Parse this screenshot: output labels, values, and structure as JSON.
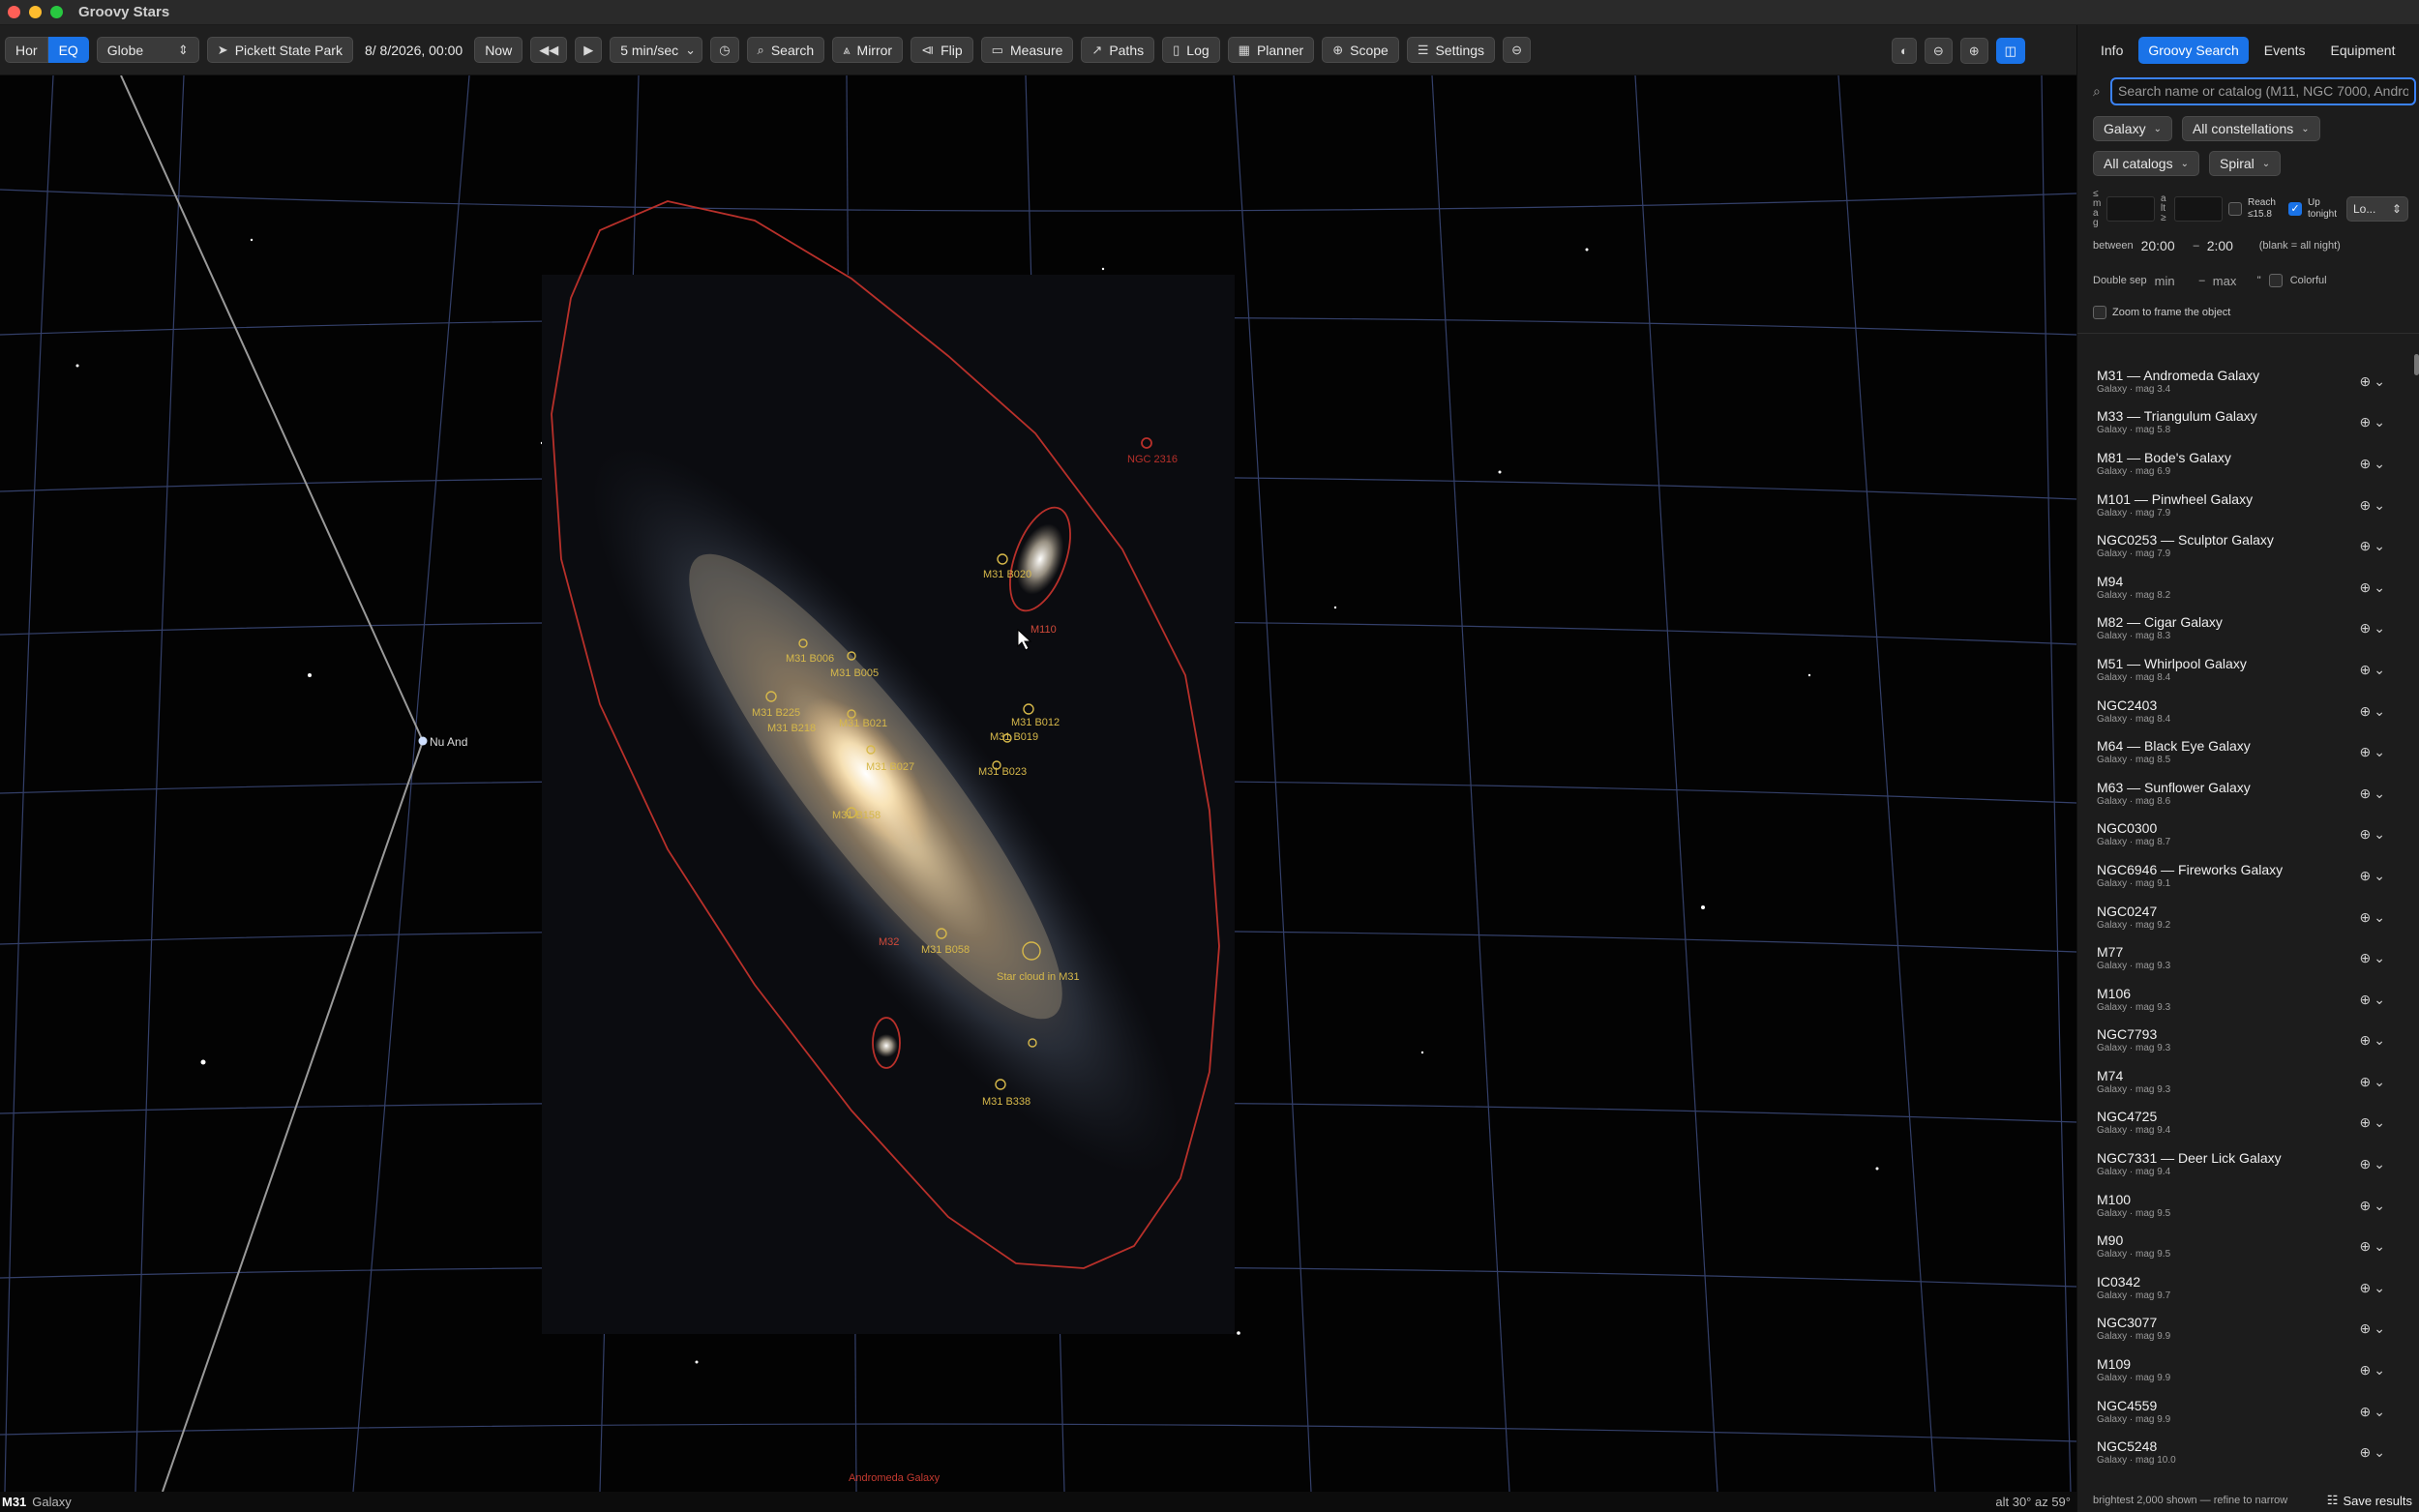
{
  "app": {
    "title": "Groovy Stars"
  },
  "toolbar": {
    "hor": "Hor",
    "eq": "EQ",
    "projection": "Globe",
    "location": "Pickett State Park",
    "date": "8/  8/2026, 00:00",
    "now": "Now",
    "rate": "5 min/sec",
    "search": "Search",
    "mirror": "Mirror",
    "flip": "Flip",
    "measure": "Measure",
    "paths": "Paths",
    "log": "Log",
    "planner": "Planner",
    "scope": "Scope",
    "settings": "Settings"
  },
  "sky": {
    "star_label": "Nu And",
    "main_label": "Andromeda Galaxy",
    "labels": {
      "ngc2316": "NGC 2316",
      "b020": "M31 B020",
      "m110": "M110",
      "b006": "M31 B006",
      "b005": "M31 B005",
      "b225": "M31 B225",
      "b218": "M31 B218",
      "b012": "M31 B012",
      "b019": "M31 B019",
      "b023": "M31 B023",
      "b021": "M31 B021",
      "b027": "M31 B027",
      "b158": "M31 B158",
      "m32": "M32",
      "b058": "M31 B058",
      "starcloud": "Star cloud in M31",
      "b338": "M31 B338"
    }
  },
  "status": {
    "object": "M31",
    "type": "Galaxy",
    "altaz": "alt 30°  az 59°"
  },
  "panel": {
    "tabs": [
      "Info",
      "Groovy Search",
      "Events",
      "Equipment"
    ],
    "search_placeholder": "Search name or catalog (M11, NGC 7000, Andromeda…)",
    "filter_type": "Galaxy",
    "filter_constellation": "All constellations",
    "filter_catalog": "All catalogs",
    "filter_morph": "Spiral",
    "mag_label": [
      "≤",
      "m",
      "a",
      "g"
    ],
    "alt_label": [
      "a",
      "lt",
      "≥"
    ],
    "reach": "Reach ≤15.8",
    "up_tonight": "Up tonight",
    "loc_select": "Lo...",
    "between": "between",
    "time_from": "20:00",
    "dash": "–",
    "time_to": "2:00",
    "blank_note": "(blank = all night)",
    "double_sep": "Double sep",
    "min": "min",
    "max": "max",
    "deg": "\"",
    "colorful": "Colorful",
    "zoom_frame": "Zoom to frame the object",
    "footer_note": "brightest 2,000 shown — refine to narrow",
    "save_results": "Save results"
  },
  "results": [
    {
      "name": "M31 — Andromeda Galaxy",
      "sub": "Galaxy · mag 3.4"
    },
    {
      "name": "M33 — Triangulum Galaxy",
      "sub": "Galaxy · mag 5.8"
    },
    {
      "name": "M81 — Bode's Galaxy",
      "sub": "Galaxy · mag 6.9"
    },
    {
      "name": "M101 — Pinwheel Galaxy",
      "sub": "Galaxy · mag 7.9"
    },
    {
      "name": "NGC0253 — Sculptor Galaxy",
      "sub": "Galaxy · mag 7.9"
    },
    {
      "name": "M94",
      "sub": "Galaxy · mag 8.2"
    },
    {
      "name": "M82 — Cigar Galaxy",
      "sub": "Galaxy · mag 8.3"
    },
    {
      "name": "M51 — Whirlpool Galaxy",
      "sub": "Galaxy · mag 8.4"
    },
    {
      "name": "NGC2403",
      "sub": "Galaxy · mag 8.4"
    },
    {
      "name": "M64 — Black Eye Galaxy",
      "sub": "Galaxy · mag 8.5"
    },
    {
      "name": "M63 — Sunflower Galaxy",
      "sub": "Galaxy · mag 8.6"
    },
    {
      "name": "NGC0300",
      "sub": "Galaxy · mag 8.7"
    },
    {
      "name": "NGC6946 — Fireworks Galaxy",
      "sub": "Galaxy · mag 9.1"
    },
    {
      "name": "NGC0247",
      "sub": "Galaxy · mag 9.2"
    },
    {
      "name": "M77",
      "sub": "Galaxy · mag 9.3"
    },
    {
      "name": "M106",
      "sub": "Galaxy · mag 9.3"
    },
    {
      "name": "NGC7793",
      "sub": "Galaxy · mag 9.3"
    },
    {
      "name": "M74",
      "sub": "Galaxy · mag 9.3"
    },
    {
      "name": "NGC4725",
      "sub": "Galaxy · mag 9.4"
    },
    {
      "name": "NGC7331 — Deer Lick Galaxy",
      "sub": "Galaxy · mag 9.4"
    },
    {
      "name": "M100",
      "sub": "Galaxy · mag 9.5"
    },
    {
      "name": "M90",
      "sub": "Galaxy · mag 9.5"
    },
    {
      "name": "IC0342",
      "sub": "Galaxy · mag 9.7"
    },
    {
      "name": "NGC3077",
      "sub": "Galaxy · mag 9.9"
    },
    {
      "name": "M109",
      "sub": "Galaxy · mag 9.9"
    },
    {
      "name": "NGC4559",
      "sub": "Galaxy · mag 9.9"
    },
    {
      "name": "NGC5248",
      "sub": "Galaxy · mag 10.0"
    }
  ]
}
